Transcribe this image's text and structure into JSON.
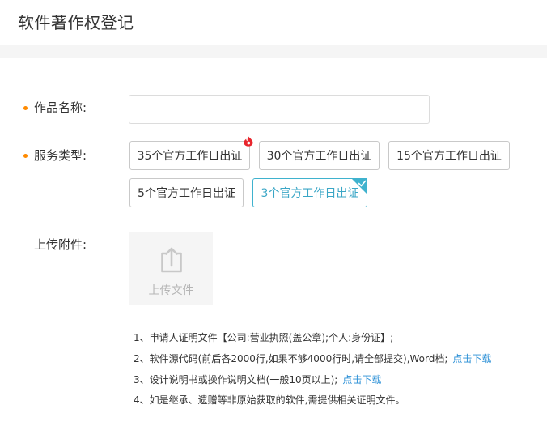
{
  "header": {
    "title": "软件著作权登记"
  },
  "form": {
    "name_label": "作品名称:",
    "name_value": "",
    "name_placeholder": "",
    "service_label": "服务类型:",
    "service_options": [
      {
        "label": "35个官方工作日出证",
        "selected": false,
        "hot": true
      },
      {
        "label": "30个官方工作日出证",
        "selected": false,
        "hot": false
      },
      {
        "label": "15个官方工作日出证",
        "selected": false,
        "hot": false
      },
      {
        "label": "5个官方工作日出证",
        "selected": false,
        "hot": false
      },
      {
        "label": "3个官方工作日出证",
        "selected": true,
        "hot": false
      }
    ],
    "attachment_label": "上传附件:",
    "upload_button_label": "上传文件"
  },
  "notes": [
    {
      "text": "1、申请人证明文件【公司:营业执照(盖公章);个人:身份证】;",
      "link": ""
    },
    {
      "text": "2、软件源代码(前后各2000行,如果不够4000行时,请全部提交),Word档;",
      "link": "点击下载"
    },
    {
      "text": "3、设计说明书或操作说明文档(一般10页以上);",
      "link": "点击下载"
    },
    {
      "text": "4、如是继承、遗赠等非原始获取的软件,需提供相关证明文件。",
      "link": ""
    }
  ],
  "colors": {
    "accent": "#3fb2ce",
    "required_dot": "#ff8a00",
    "link": "#2a8fd6",
    "hot_badge": "#e8262d"
  }
}
